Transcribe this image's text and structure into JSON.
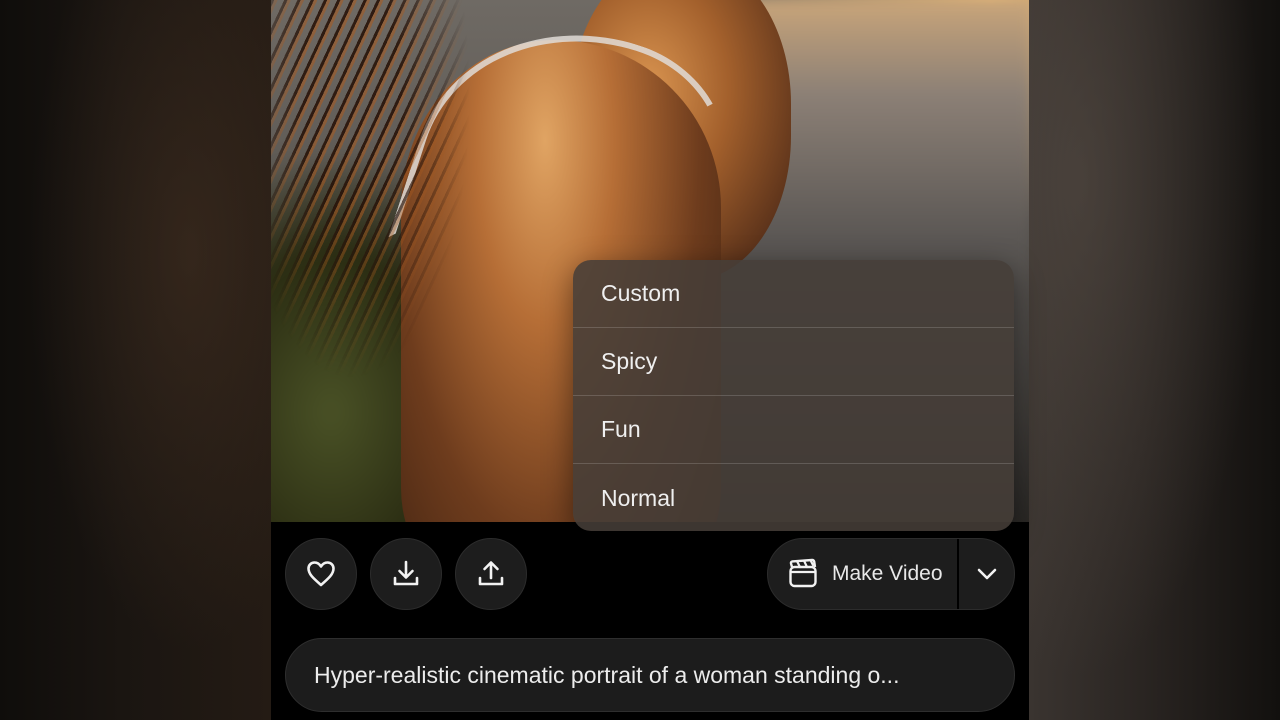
{
  "dropdown": {
    "items": [
      {
        "label": "Custom"
      },
      {
        "label": "Spicy"
      },
      {
        "label": "Fun"
      },
      {
        "label": "Normal"
      }
    ]
  },
  "actions": {
    "like_icon": "heart-icon",
    "download_icon": "download-icon",
    "share_icon": "share-icon",
    "make_video": {
      "label": "Make Video",
      "icon": "clapperboard-icon",
      "dropdown_icon": "chevron-down-icon"
    }
  },
  "prompt": {
    "text": "Hyper-realistic cinematic portrait of a woman standing o..."
  },
  "colors": {
    "background": "#000000",
    "button_bg": "#1d1d1d",
    "menu_bg": "#463e38",
    "text": "#ececec"
  }
}
